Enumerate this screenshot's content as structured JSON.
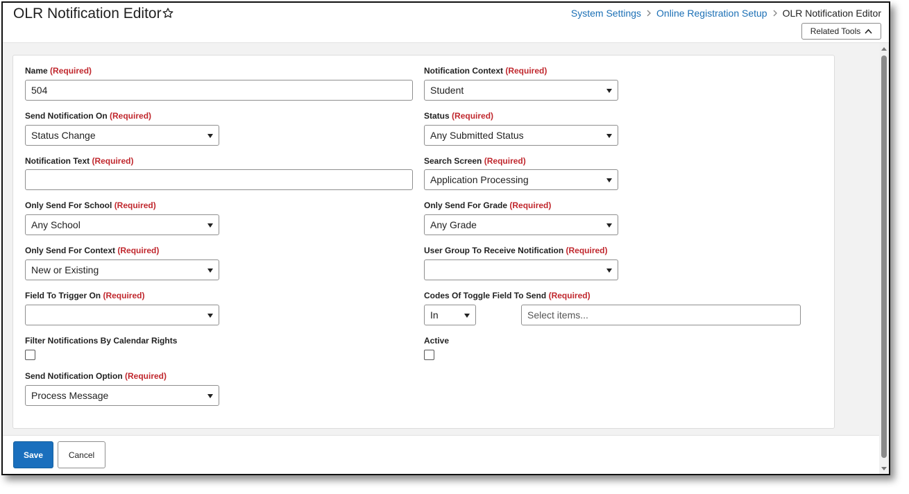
{
  "header": {
    "title": "OLR Notification Editor",
    "breadcrumb": [
      "System Settings",
      "Online Registration Setup",
      "OLR Notification Editor"
    ],
    "related_tools": "Related Tools"
  },
  "required_tag": "(Required)",
  "fields": {
    "name": {
      "label": "Name",
      "value": "504"
    },
    "notification_context": {
      "label": "Notification Context",
      "value": "Student"
    },
    "send_notification_on": {
      "label": "Send Notification On",
      "value": "Status Change"
    },
    "status": {
      "label": "Status",
      "value": "Any Submitted Status"
    },
    "notification_text": {
      "label": "Notification Text",
      "value": ""
    },
    "search_screen": {
      "label": "Search Screen",
      "value": "Application Processing"
    },
    "only_send_for_school": {
      "label": "Only Send For School",
      "value": "Any School"
    },
    "only_send_for_grade": {
      "label": "Only Send For Grade",
      "value": "Any Grade"
    },
    "only_send_for_context": {
      "label": "Only Send For Context",
      "value": "New or Existing"
    },
    "user_group": {
      "label": "User Group To Receive Notification",
      "value": ""
    },
    "field_to_trigger_on": {
      "label": "Field To Trigger On",
      "value": ""
    },
    "codes_of_toggle": {
      "label": "Codes Of Toggle Field To Send",
      "operator": "In",
      "placeholder": "Select items..."
    },
    "filter_by_calendar_rights": {
      "label": "Filter Notifications By Calendar Rights",
      "checked": false
    },
    "active": {
      "label": "Active",
      "checked": false
    },
    "send_notification_option": {
      "label": "Send Notification Option",
      "value": "Process Message"
    }
  },
  "footer": {
    "save_label": "Save",
    "cancel_label": "Cancel"
  },
  "icons": {
    "favorite": "star-outline-icon",
    "breadcrumb_separator": "chevron-right-icon",
    "related_tools_toggle": "chevron-up-icon",
    "select_caret": "caret-down-icon"
  },
  "colors": {
    "link": "#1b6fb5",
    "required": "#c0272d",
    "primary_button": "#1a6fbd",
    "content_background": "#f2f2f2"
  }
}
